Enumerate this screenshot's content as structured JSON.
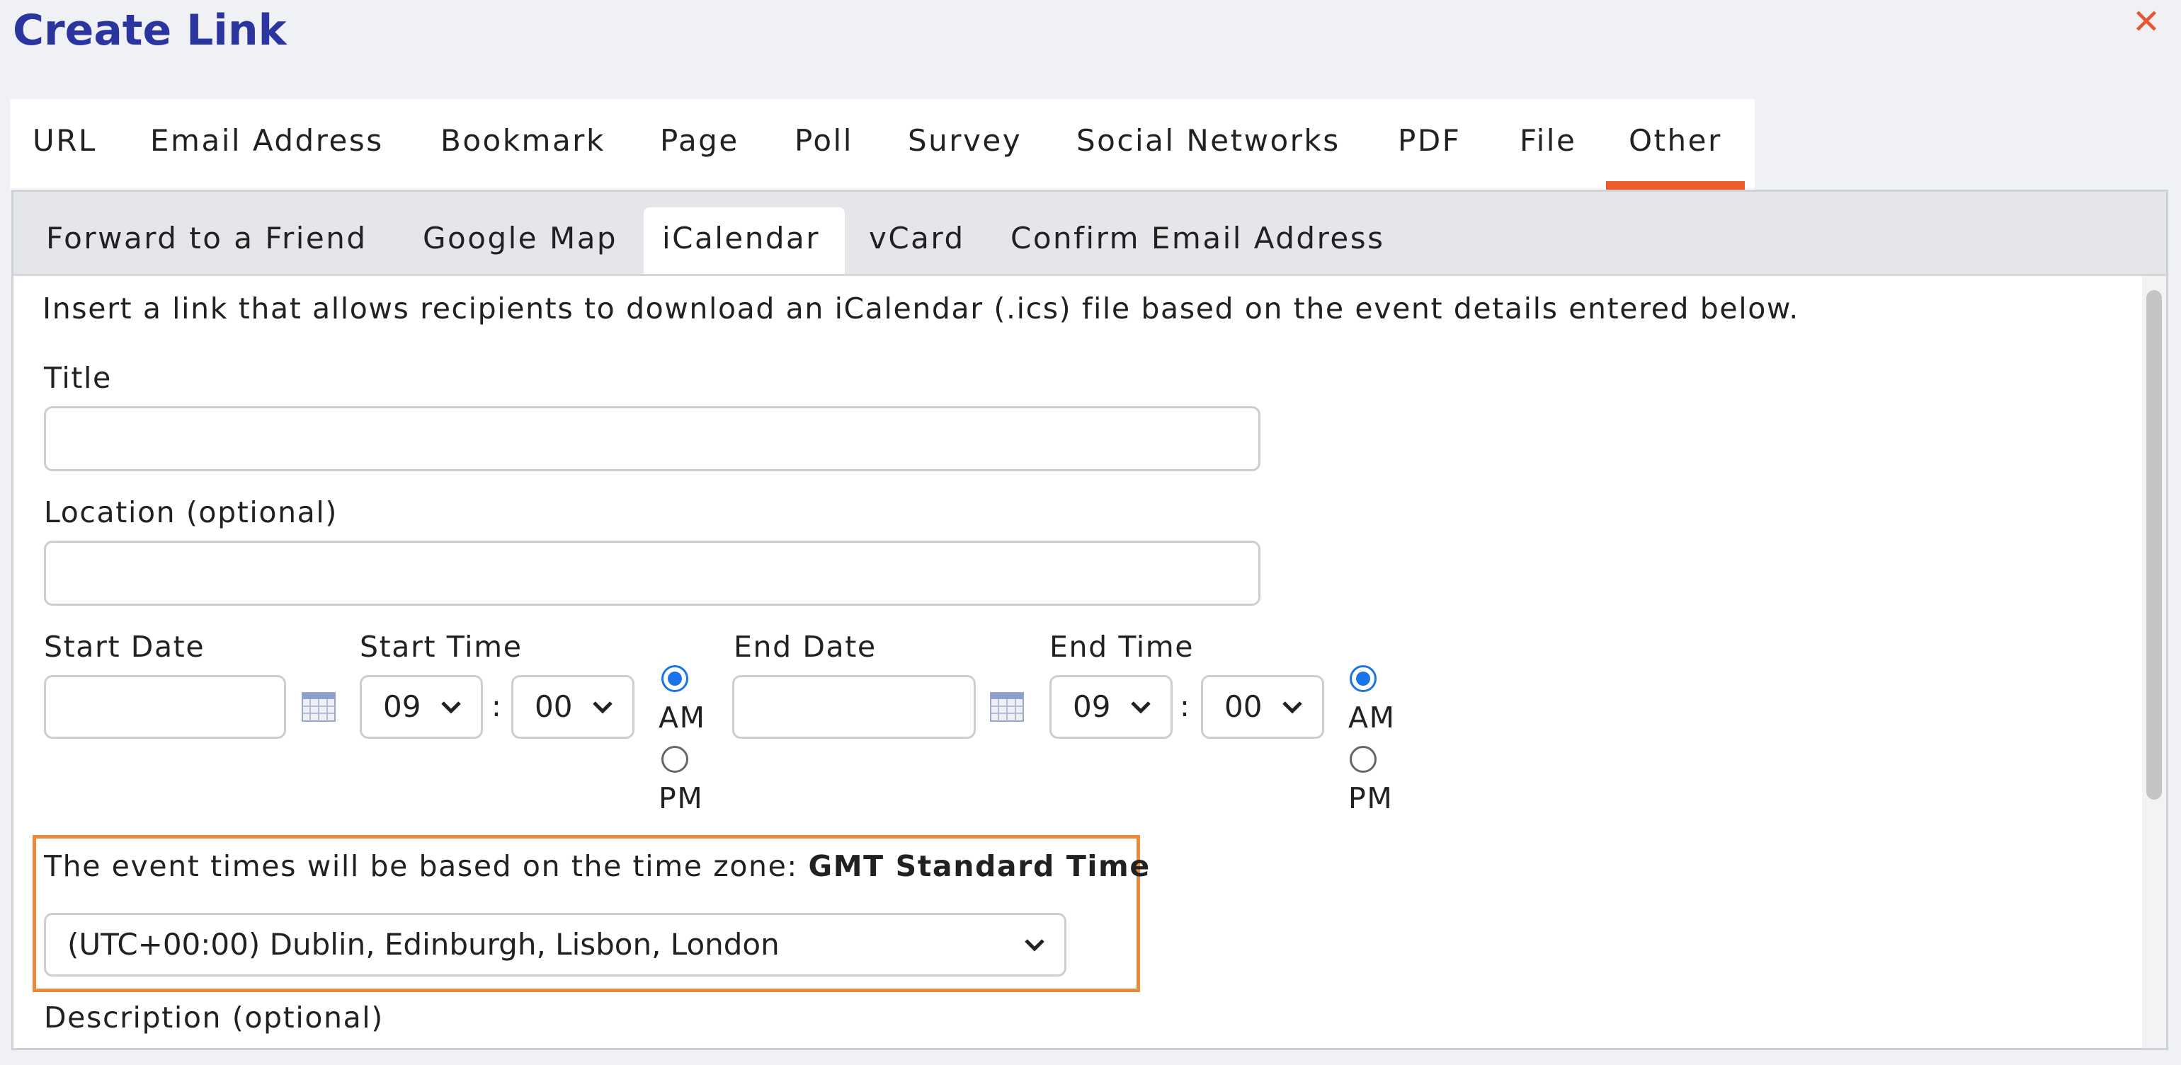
{
  "dialog": {
    "title": "Create Link",
    "close_icon": "close-icon",
    "close_symbol": "✕"
  },
  "top_tabs": [
    {
      "label": "URL"
    },
    {
      "label": "Email Address"
    },
    {
      "label": "Bookmark"
    },
    {
      "label": "Page"
    },
    {
      "label": "Poll"
    },
    {
      "label": "Survey"
    },
    {
      "label": "Social Networks"
    },
    {
      "label": "PDF"
    },
    {
      "label": "File"
    },
    {
      "label": "Other",
      "active": true
    }
  ],
  "sub_tabs": [
    {
      "label": "Forward to a Friend"
    },
    {
      "label": "Google Map"
    },
    {
      "label": "iCalendar",
      "active": true
    },
    {
      "label": "vCard"
    },
    {
      "label": "Confirm Email Address"
    }
  ],
  "form": {
    "intro": "Insert a link that allows recipients to download an iCalendar (.ics) file based on the event details entered below.",
    "title_label": "Title",
    "title_value": "",
    "location_label": "Location (optional)",
    "location_value": "",
    "start_date_label": "Start Date",
    "start_date_value": "",
    "start_time_label": "Start Time",
    "start_hour": "09",
    "start_minute": "00",
    "start_ampm": "AM",
    "end_date_label": "End Date",
    "end_date_value": "",
    "end_time_label": "End Time",
    "end_hour": "09",
    "end_minute": "00",
    "end_ampm": "AM",
    "am_label": "AM",
    "pm_label": "PM",
    "time_sep": ":",
    "timezone_prefix": "The event times will be based on the time zone:",
    "timezone_name": "GMT Standard Time",
    "timezone_select": "(UTC+00:00) Dublin, Edinburgh, Lisbon, London",
    "description_label": "Description (optional)"
  },
  "colors": {
    "title": "#2b35a0",
    "accent": "#ef5a2c",
    "highlight_box": "#e98a3c",
    "radio_selected": "#1a73e8"
  }
}
